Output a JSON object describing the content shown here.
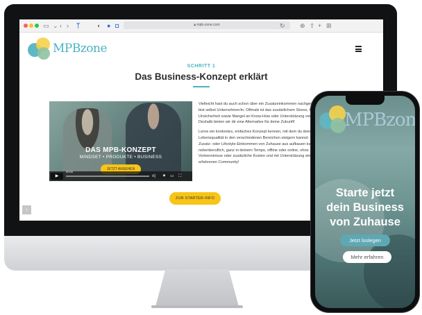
{
  "browser": {
    "url": "mpb-zone.com",
    "toolbar_icons": [
      "sidebar-icon",
      "back-icon",
      "forward-icon",
      "extension-icon",
      "shield-icon",
      "info-icon",
      "camera-icon",
      "reload-icon",
      "download-icon",
      "share-icon",
      "new-tab-icon",
      "tabs-icon"
    ]
  },
  "site": {
    "logo_text": "MPBzone",
    "step_label": "SCHRITT 1",
    "title": "Das Business-Konzept erklärt",
    "accent_color": "#49b3c1",
    "button_color": "#f7c417"
  },
  "video": {
    "title": "DAS MPB-KONZEPT",
    "subtitle": "MINDSET • PRODUKTE • BUSINESS",
    "button_label": "JETZT ANSEHEN",
    "time": "00:00",
    "progress": 0
  },
  "content": {
    "paragraph1": "Vielleicht hast du auch schon über ein Zusatzeinkommen nachgedacht, oder bist selbst Unternehmer/in. Oftmals ist das zusätzlichem Stress, Kosten, Unsicherheit sowie Mangel an Know-How oder Unterstützung verbunden. Deshalb bieten wir dir eine Alternative für deine Zukunft!",
    "paragraph2": "Lerne ein konkretes, einfaches Konzept kennen, mit dem du deine Lebensqualität in den verschiedenen Bereichen steigern kannst: flexibel ein Zusatz- oder Lifestyle-Einkommen von Zuhause aus aufbauen kannst – nebenberuflich, ganz in deinem Tempo, offline oder online, ohne Vorkenntnisse oder zusätzliche Kosten und mit Unterstützung einer erfahrenen Community!",
    "cta_label": "ZUR STARTER-INFO"
  },
  "phone": {
    "logo_text": "MPBzone",
    "headline_line1": "Starte jetzt",
    "headline_line2": "dein Business",
    "headline_line3": "von Zuhause",
    "primary_button": "Jetzt loslegen",
    "secondary_button": "Mehr erfahren"
  }
}
